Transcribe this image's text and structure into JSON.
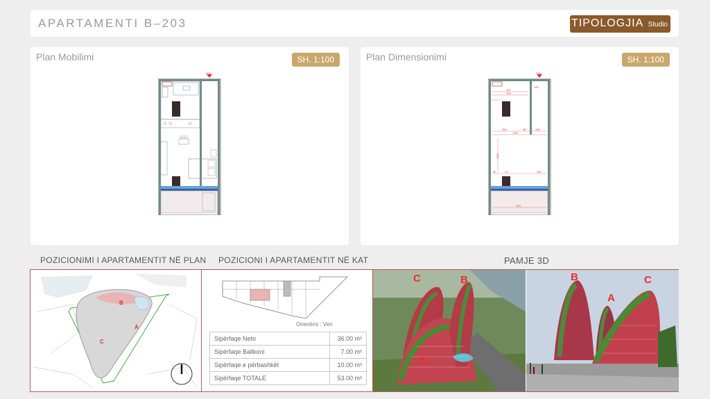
{
  "header": {
    "title": "APARTAMENTI  B–203",
    "typology_label": "TIPOLOGJIA",
    "typology_value": "Studio"
  },
  "plan_furniture": {
    "title": "Plan Mobilimi",
    "scale": "SH. 1:100",
    "marker": "203"
  },
  "plan_dimension": {
    "title": "Plan Dimensionimi",
    "scale": "SH. 1:100",
    "marker": "203",
    "dims": [
      "147",
      "206",
      "120",
      "393",
      "98",
      "130",
      "378",
      "520",
      "90",
      "77",
      "100",
      "403"
    ]
  },
  "sections": {
    "position_plan": "POZICIONIMI I APARTAMENTIT NË PLAN",
    "position_floor": "POZICIONI I APARTAMENTIT NË KAT",
    "view_3d": "PAMJE 3D"
  },
  "site_labels": [
    "A",
    "B",
    "C"
  ],
  "orientation": "Orientimi :  Veri",
  "areas": [
    {
      "label": "Sipërfaqe Neto",
      "value": "36.00  m²"
    },
    {
      "label": "Sipërfaqe Ballkoni",
      "value": "7.00  m²"
    },
    {
      "label": "Sipërfaqe e përbashkët",
      "value": "10.00  m²"
    },
    {
      "label": "Sipërfaqe TOTALE",
      "value": "53.00  m²"
    }
  ],
  "render_labels": {
    "left": [
      "C",
      "B",
      "A"
    ],
    "right": [
      "B",
      "A",
      "C"
    ]
  },
  "colors": {
    "badge_brown": "#8a5a2b",
    "badge_gold": "#c9a76b",
    "frame_red": "#b55a5a",
    "label_red": "#e8302a"
  }
}
